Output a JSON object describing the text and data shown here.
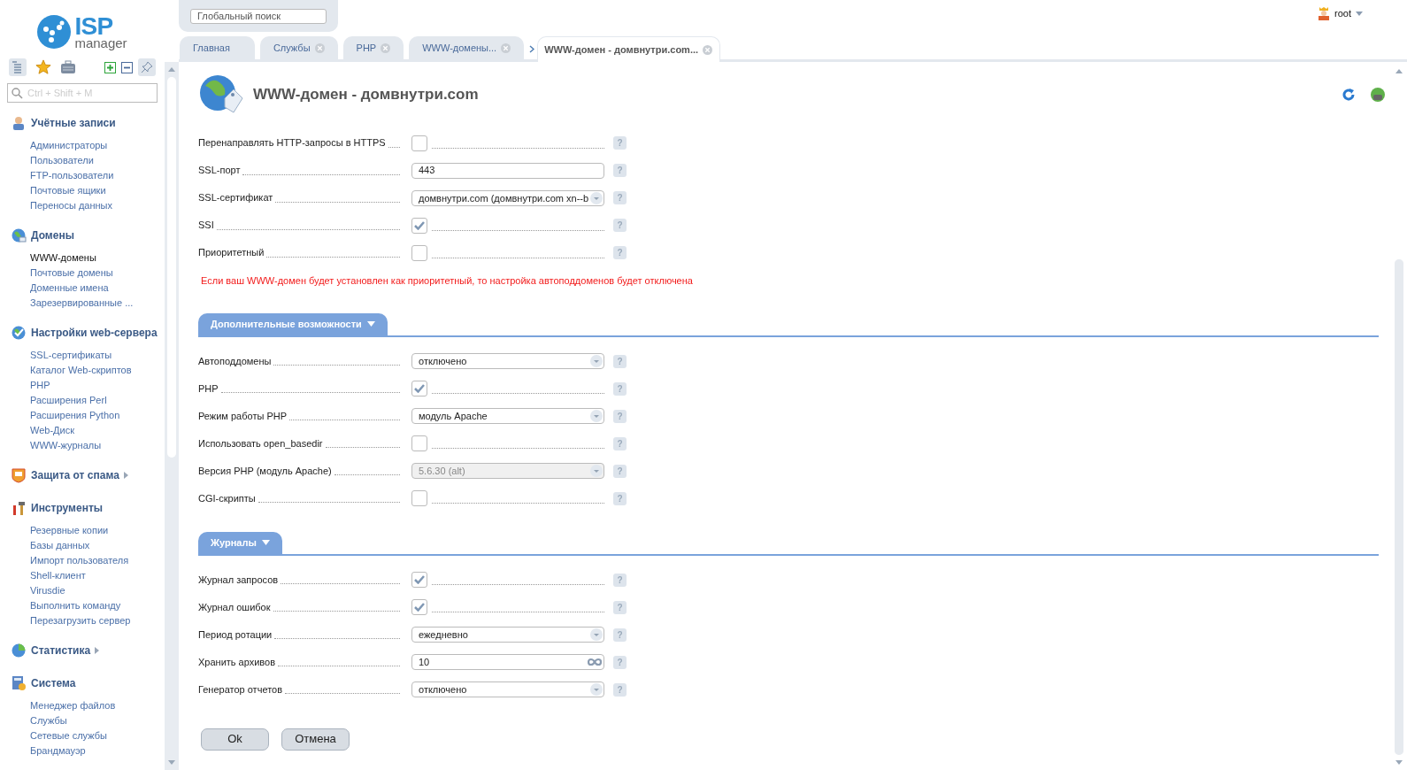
{
  "logo": {
    "line1": "ISP",
    "line2": "manager"
  },
  "global_search": {
    "placeholder": "Глобальный поиск"
  },
  "user": {
    "name": "root"
  },
  "sidebar": {
    "search": {
      "placeholder": "Ctrl + Shift + M"
    },
    "sections": [
      {
        "title": "Учётные записи",
        "expanded": true,
        "items": [
          {
            "label": "Администраторы",
            "selected": false
          },
          {
            "label": "Пользователи",
            "selected": false
          },
          {
            "label": "FTP-пользователи",
            "selected": false
          },
          {
            "label": "Почтовые ящики",
            "selected": false
          },
          {
            "label": "Переносы данных",
            "selected": false
          }
        ]
      },
      {
        "title": "Домены",
        "expanded": true,
        "items": [
          {
            "label": "WWW-домены",
            "selected": true
          },
          {
            "label": "Почтовые домены",
            "selected": false
          },
          {
            "label": "Доменные имена",
            "selected": false
          },
          {
            "label": "Зарезервированные ...",
            "selected": false
          }
        ]
      },
      {
        "title": "Настройки web-сервера",
        "expanded": true,
        "items": [
          {
            "label": "SSL-сертификаты",
            "selected": false
          },
          {
            "label": "Каталог Web-скриптов",
            "selected": false
          },
          {
            "label": "PHP",
            "selected": false
          },
          {
            "label": "Расширения Perl",
            "selected": false
          },
          {
            "label": "Расширения Python",
            "selected": false
          },
          {
            "label": "Web-Диск",
            "selected": false
          },
          {
            "label": "WWW-журналы",
            "selected": false
          }
        ]
      },
      {
        "title": "Защита от спама",
        "expanded": false
      },
      {
        "title": "Инструменты",
        "expanded": true,
        "items": [
          {
            "label": "Резервные копии",
            "selected": false
          },
          {
            "label": "Базы данных",
            "selected": false
          },
          {
            "label": "Импорт пользователя",
            "selected": false
          },
          {
            "label": "Shell-клиент",
            "selected": false
          },
          {
            "label": "Virusdie",
            "selected": false
          },
          {
            "label": "Выполнить команду",
            "selected": false
          },
          {
            "label": "Перезагрузить сервер",
            "selected": false
          }
        ]
      },
      {
        "title": "Статистика",
        "expanded": false
      },
      {
        "title": "Система",
        "expanded": true,
        "items": [
          {
            "label": "Менеджер файлов",
            "selected": false
          },
          {
            "label": "Службы",
            "selected": false
          },
          {
            "label": "Сетевые службы",
            "selected": false
          },
          {
            "label": "Брандмауэр",
            "selected": false
          }
        ]
      }
    ]
  },
  "tabs": [
    {
      "label": "Главная",
      "closable": false,
      "nested": false,
      "selected": false
    },
    {
      "label": "Службы",
      "closable": true,
      "nested": false,
      "selected": false
    },
    {
      "label": "PHP",
      "closable": true,
      "nested": false,
      "selected": false
    },
    {
      "label": "WWW-домены...",
      "closable": true,
      "nested": false,
      "selected": false
    },
    {
      "label": "WWW-домен - домвнутри.com...",
      "closable": true,
      "nested": true,
      "selected": true
    }
  ],
  "page": {
    "title": "WWW-домен - домвнутри.com"
  },
  "form": {
    "help_mark": "?",
    "sections": [
      {
        "fields": [
          {
            "kind": "checkbox",
            "label": "Перенаправлять HTTP-запросы в HTTPS",
            "checked": false
          },
          {
            "kind": "text",
            "label": "SSL-порт",
            "value": "443"
          },
          {
            "kind": "select",
            "label": "SSL-сертификат",
            "value": "домвнутри.com (домвнутри.com xn--b",
            "disabled": false
          },
          {
            "kind": "checkbox",
            "label": "SSI",
            "checked": true
          },
          {
            "kind": "checkbox",
            "label": "Приоритетный",
            "checked": false
          }
        ],
        "note": "Если ваш WWW-домен будет установлен как приоритетный, то настройка автоподдоменов будет отключена"
      },
      {
        "title": "Дополнительные возможности",
        "expanded": true,
        "fields": [
          {
            "kind": "select",
            "label": "Автоподдомены",
            "value": "отключено",
            "disabled": false
          },
          {
            "kind": "checkbox",
            "label": "PHP",
            "checked": true
          },
          {
            "kind": "select",
            "label": "Режим работы PHP",
            "value": "модуль Apache",
            "disabled": false
          },
          {
            "kind": "checkbox",
            "label": "Использовать open_basedir",
            "checked": false
          },
          {
            "kind": "select",
            "label": "Версия PHP (модуль Apache)",
            "value": "5.6.30 (alt)",
            "disabled": true
          },
          {
            "kind": "checkbox",
            "label": "CGI-скрипты",
            "checked": false
          }
        ]
      },
      {
        "title": "Журналы",
        "expanded": true,
        "fields": [
          {
            "kind": "checkbox",
            "label": "Журнал запросов",
            "checked": true
          },
          {
            "kind": "checkbox",
            "label": "Журнал ошибок",
            "checked": true
          },
          {
            "kind": "select",
            "label": "Период ротации",
            "value": "ежедневно",
            "disabled": false
          },
          {
            "kind": "unlimited",
            "label": "Хранить архивов",
            "value": "10"
          },
          {
            "kind": "select",
            "label": "Генератор отчетов",
            "value": "отключено",
            "disabled": false
          }
        ]
      }
    ],
    "buttons": [
      "Ok",
      "Отмена"
    ]
  }
}
